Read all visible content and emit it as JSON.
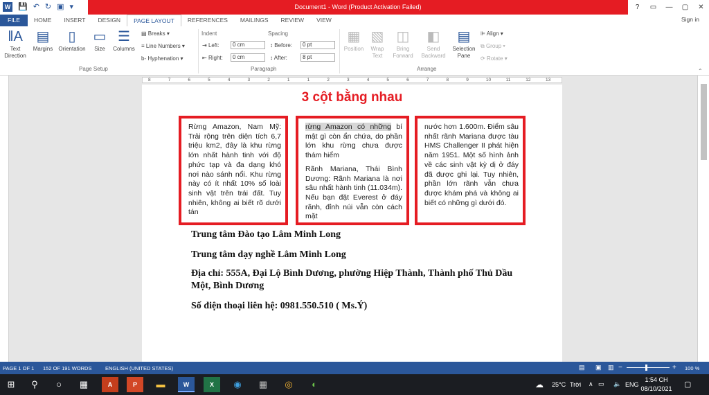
{
  "window": {
    "title": "Document1 - Word (Product Activation Failed)",
    "controls": [
      "?",
      "▭",
      "—",
      "▢",
      "✕"
    ]
  },
  "qat": {
    "save_icon": "save-icon",
    "undo_icon": "undo-icon",
    "redo_icon": "redo-icon",
    "print_icon": "print-icon"
  },
  "tabs": [
    "FILE",
    "HOME",
    "INSERT",
    "DESIGN",
    "PAGE LAYOUT",
    "REFERENCES",
    "MAILINGS",
    "REVIEW",
    "VIEW"
  ],
  "sign_in": "Sign in",
  "ribbon": {
    "page_setup": {
      "label": "Page Setup",
      "text_direction": "Text Direction",
      "margins": "Margins",
      "orientation": "Orientation",
      "size": "Size",
      "columns": "Columns",
      "breaks": "Breaks",
      "line_numbers": "Line Numbers",
      "hyphenation": "Hyphenation"
    },
    "paragraph": {
      "label": "Paragraph",
      "indent": "Indent",
      "spacing": "Spacing",
      "left": "Left:",
      "right": "Right:",
      "before": "Before:",
      "after": "After:",
      "left_value": "0 cm",
      "right_value": "0 cm",
      "before_value": "0 pt",
      "after_value": "8 pt"
    },
    "arrange": {
      "label": "Arrange",
      "position": "Position",
      "wrap_text": "Wrap Text",
      "bring_forward": "Bring Forward",
      "send_backward": "Send Backward",
      "selection_pane": "Selection Pane",
      "align": "Align",
      "group": "Group",
      "rotate": "Rotate"
    }
  },
  "ruler": [
    "8",
    "7",
    "6",
    "5",
    "4",
    "3",
    "2",
    "1",
    "1",
    "2",
    "3",
    "4",
    "5",
    "6",
    "7",
    "8",
    "9",
    "10",
    "11",
    "12",
    "13"
  ],
  "document": {
    "heading": "3 cột bằng nhau",
    "col1": "Rừng Amazon, Nam Mỹ: Trải rộng trên diện tích 6,7 triệu km2, đây là khu rừng lớn nhất hành tinh với độ phức tạp và đa dạng khó nơi nào sánh nổi. Khu rừng này có ít nhất 10% số loài sinh vật trên trái đất. Tuy nhiên, không ai biết rõ dưới tán",
    "col2_selected": "rừng Amazon có những",
    "col2_p1_rest": "bí mật gì còn ẩn chứa, do phần lớn khu rừng chưa được thám hiểm",
    "col2_p2": "Rãnh Mariana, Thái Bình Dương: Rãnh Mariana là nơi sâu nhất hành tinh (11.034m). Nếu bạn đặt Everest ở đáy rãnh, đỉnh núi vẫn còn cách mặt",
    "col3": "nước hơn 1.600m. Điểm sâu nhất rãnh Mariana được tàu HMS Challenger II phát hiện năm 1951. Một số hình ảnh về các sinh vật kỳ dị ở đáy đã được ghi lại. Tuy nhiên, phần lớn rãnh vẫn chưa được khám phá và không ai biết có những gì dưới đó.",
    "line1": "Trung tâm Đào tạo Lâm Minh Long",
    "line2": "Trung tâm dạy nghề Lâm Minh Long",
    "line3": "Địa chỉ: 555A, Đại Lộ Bình Dương, phường Hiệp Thành, Thành phố Thủ Dầu Một, Bình Dương",
    "line4": "Số điện thoại liên hệ: 0981.550.510 ( Ms.Ý)"
  },
  "status": {
    "page": "PAGE 1 OF 1",
    "words": "152 OF 191 WORDS",
    "language": "ENGLISH (UNITED STATES)",
    "zoom": "100 %"
  },
  "taskbar": {
    "weather": "25°C",
    "weather_desc": "Trời",
    "lang": "ENG",
    "time": "1:54 CH",
    "date": "08/10/2021"
  },
  "colors": {
    "accent": "#2b579a",
    "red": "#e51c23"
  }
}
